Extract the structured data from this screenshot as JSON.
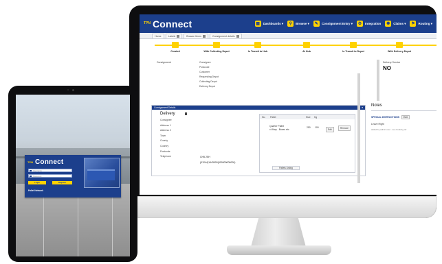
{
  "desktop": {
    "app": {
      "logo_small": "TPN",
      "logo_text": "Connect"
    },
    "nav": [
      {
        "label": "Dashboards ▾",
        "icon": "dashboard-icon"
      },
      {
        "label": "Browse ▾",
        "icon": "search-icon"
      },
      {
        "label": "Consignment Entry ▾",
        "icon": "pen-icon"
      },
      {
        "label": "Integration",
        "icon": "gears-icon"
      },
      {
        "label": "Claims ▾",
        "icon": "badge-icon"
      },
      {
        "label": "Routing ▾",
        "icon": "pin-icon"
      }
    ],
    "tabs": [
      "Home",
      "Labels",
      "Browse Items",
      "Consignment details"
    ],
    "progress_steps": [
      "Created",
      "With Collecting Depot",
      "In Transit to Hub",
      "At Hub",
      "In Transit to Depot",
      "With Delivery Depot"
    ],
    "info": {
      "label": "Consignment",
      "rows": [
        "Consignee",
        "Postcode",
        "Customer",
        "Requesting Depot",
        "Collecting Depot",
        "Delivery Depot"
      ],
      "right_label": "Delivery Service",
      "right_value": "NO"
    },
    "details": {
      "header": "Consignment Details",
      "section_title": "Delivery",
      "field_labels": [
        "Consignee",
        "Address 1",
        "Address 2",
        "Town",
        "County",
        "Country",
        "Postcode",
        "Telephone"
      ],
      "postcode": "CH5 2SH",
      "telephone": "(01244)1443000(000000000000)",
      "pallets": {
        "headers": [
          "No.",
          "Pallet",
          "Size",
          "Kg"
        ],
        "row_line1": "Quarter Pallet",
        "row_line2": "x Wrap · Boxes etc",
        "qty": "250",
        "kg": "100",
        "edit_button": "Edit",
        "remove_button": "Remove",
        "footer_button": "Pallets Listing"
      }
    },
    "notes": {
      "title": "Notes",
      "tag": "SPECIAL INSTRUCTIONS",
      "edit": "Edit",
      "text": "Leave Right",
      "meta": "added by admin user · see booking ref"
    }
  },
  "tablet": {
    "logo_small": "TPN",
    "logo_text": "Connect",
    "username_placeholder": "Username",
    "password_placeholder": "Password",
    "login_button": "Login",
    "register_button": "Register",
    "forgot": "Pallet Network"
  }
}
